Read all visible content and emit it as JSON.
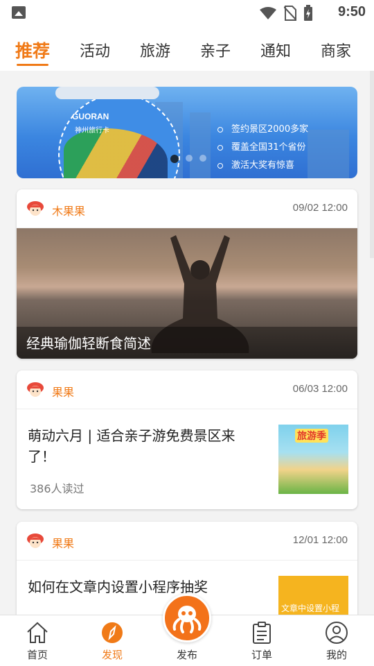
{
  "status_bar": {
    "time": "9:50"
  },
  "tabs": [
    {
      "label": "推荐",
      "active": true
    },
    {
      "label": "活动",
      "active": false
    },
    {
      "label": "旅游",
      "active": false
    },
    {
      "label": "亲子",
      "active": false
    },
    {
      "label": "通知",
      "active": false
    },
    {
      "label": "商家",
      "active": false
    }
  ],
  "banner": {
    "logo": "GUORAN",
    "card_name": "神州旅行卡",
    "features": [
      "签约景区2000多家",
      "覆盖全国31个省份",
      "激活大奖有惊喜"
    ]
  },
  "cards": [
    {
      "author": "木果果",
      "date": "09/02 12:00",
      "caption": "经典瑜伽轻断食简述"
    },
    {
      "author": "果果",
      "date": "06/03 12:00",
      "title": "萌动六月 | 适合亲子游免费景区来了！",
      "reads": "386人读过",
      "thumb_text": "旅游季"
    },
    {
      "author": "果果",
      "date": "12/01 12:00",
      "title": "如何在文章内设置小程序抽奖",
      "thumb_text": "文章中设置小程"
    }
  ],
  "bottom_nav": [
    {
      "label": "首页",
      "icon": "home-icon"
    },
    {
      "label": "发现",
      "icon": "compass-icon",
      "active": true
    },
    {
      "label": "发布",
      "icon": "octopus-icon"
    },
    {
      "label": "订单",
      "icon": "clipboard-icon"
    },
    {
      "label": "我的",
      "icon": "user-icon"
    }
  ],
  "colors": {
    "accent": "#f07a17",
    "publish": "#f3721a"
  }
}
